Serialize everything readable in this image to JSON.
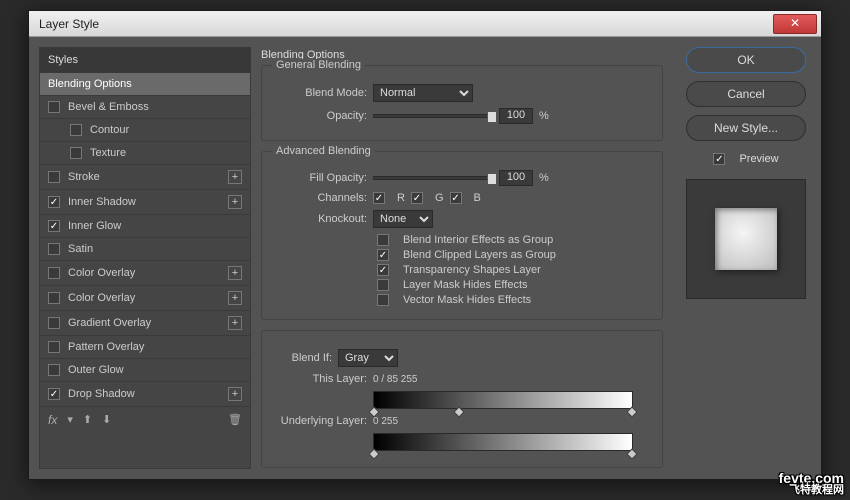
{
  "title": "Layer Style",
  "sidebar": {
    "header": "Styles",
    "items": [
      {
        "label": "Blending Options",
        "checked": null,
        "selected": true,
        "plus": false,
        "indent": false
      },
      {
        "label": "Bevel & Emboss",
        "checked": false,
        "plus": false,
        "indent": false
      },
      {
        "label": "Contour",
        "checked": false,
        "plus": false,
        "indent": true
      },
      {
        "label": "Texture",
        "checked": false,
        "plus": false,
        "indent": true
      },
      {
        "label": "Stroke",
        "checked": false,
        "plus": true,
        "indent": false
      },
      {
        "label": "Inner Shadow",
        "checked": true,
        "plus": true,
        "indent": false
      },
      {
        "label": "Inner Glow",
        "checked": true,
        "plus": false,
        "indent": false
      },
      {
        "label": "Satin",
        "checked": false,
        "plus": false,
        "indent": false
      },
      {
        "label": "Color Overlay",
        "checked": false,
        "plus": true,
        "indent": false
      },
      {
        "label": "Color Overlay",
        "checked": false,
        "plus": true,
        "indent": false
      },
      {
        "label": "Gradient Overlay",
        "checked": false,
        "plus": true,
        "indent": false
      },
      {
        "label": "Pattern Overlay",
        "checked": false,
        "plus": false,
        "indent": false
      },
      {
        "label": "Outer Glow",
        "checked": false,
        "plus": false,
        "indent": false
      },
      {
        "label": "Drop Shadow",
        "checked": true,
        "plus": true,
        "indent": false
      }
    ],
    "fx": "fx"
  },
  "main": {
    "title": "Blending Options",
    "general": {
      "legend": "General Blending",
      "blend_mode_label": "Blend Mode:",
      "blend_mode_value": "Normal",
      "opacity_label": "Opacity:",
      "opacity_value": "100",
      "pct": "%"
    },
    "advanced": {
      "legend": "Advanced Blending",
      "fill_opacity_label": "Fill Opacity:",
      "fill_opacity_value": "100",
      "pct": "%",
      "channels_label": "Channels:",
      "ch_r": "R",
      "ch_g": "G",
      "ch_b": "B",
      "knockout_label": "Knockout:",
      "knockout_value": "None",
      "opt1": "Blend Interior Effects as Group",
      "opt2": "Blend Clipped Layers as Group",
      "opt3": "Transparency Shapes Layer",
      "opt4": "Layer Mask Hides Effects",
      "opt5": "Vector Mask Hides Effects"
    },
    "blendif": {
      "label": "Blend If:",
      "value": "Gray",
      "this_label": "This Layer:",
      "this_nums": [
        "0",
        "/",
        "85",
        "255"
      ],
      "under_label": "Underlying Layer:",
      "under_nums": [
        "0",
        "255"
      ]
    }
  },
  "buttons": {
    "ok": "OK",
    "cancel": "Cancel",
    "newstyle": "New Style...",
    "preview": "Preview"
  },
  "watermark": {
    "line1": "fevte.com",
    "line2": "飞特教程网"
  }
}
